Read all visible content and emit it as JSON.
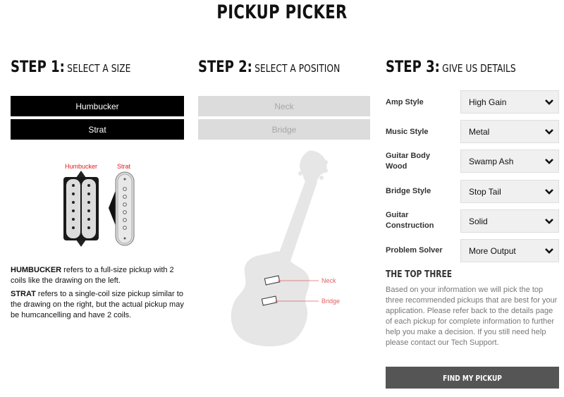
{
  "page": {
    "title": "PICKUP PICKER"
  },
  "step1": {
    "num": "STEP 1:",
    "sub": "SELECT A SIZE",
    "buttons": [
      "Humbucker",
      "Strat"
    ],
    "diagram_labels": {
      "humbucker": "Humbucker",
      "strat": "Strat"
    },
    "desc": [
      {
        "bold": "HUMBUCKER",
        "text": " refers to a full-size pickup with 2 coils like the drawing on the left."
      },
      {
        "bold": "STRAT",
        "text": " refers to a single-coil size pickup similar to the drawing on the right, but the actual pickup may be humcancelling and have 2 coils."
      }
    ]
  },
  "step2": {
    "num": "STEP 2:",
    "sub": "SELECT A POSITION",
    "buttons": [
      "Neck",
      "Bridge"
    ],
    "guitar_labels": {
      "neck": "Neck",
      "bridge": "Bridge"
    }
  },
  "step3": {
    "num": "STEP 3:",
    "sub": "GIVE US DETAILS",
    "fields": [
      {
        "label": "Amp Style",
        "value": "High Gain"
      },
      {
        "label": "Music Style",
        "value": "Metal"
      },
      {
        "label": "Guitar Body Wood",
        "value": "Swamp Ash"
      },
      {
        "label": "Bridge Style",
        "value": "Stop Tail"
      },
      {
        "label": "Guitar Construction",
        "value": "Solid"
      },
      {
        "label": "Problem Solver",
        "value": "More Output"
      }
    ],
    "top_three_title": "THE TOP THREE",
    "top_three_text": "Based on your information we will pick the top three recommended pickups that are best for your application. Please refer back to the details page of each pickup for complete information to further help you make a decision. If you still need help please contact our Tech Support.",
    "find_button": "FIND MY PICKUP"
  },
  "colors": {
    "accent_red": "#e01a1a",
    "button_dark": "#000000",
    "button_disabled": "#dcdcdc",
    "find_button": "#555555"
  }
}
